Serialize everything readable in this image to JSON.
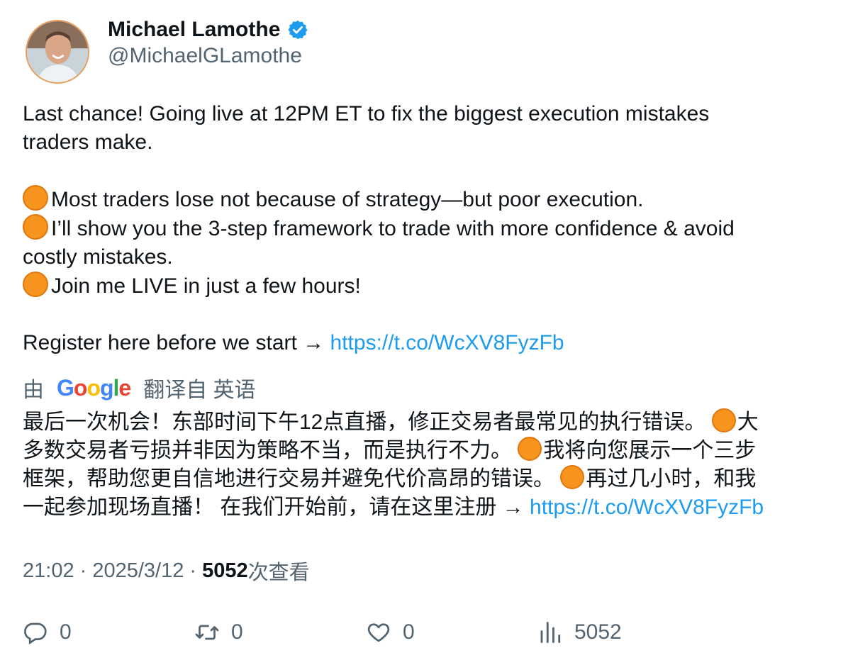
{
  "author": {
    "name": "Michael Lamothe",
    "handle": "@MichaelGLamothe",
    "verified": true,
    "verified_color": "#1d9bf0"
  },
  "tweet": {
    "lines": [
      "Last chance! Going live at 12PM ET to fix the biggest execution mistakes",
      "traders make.",
      "Most traders lose not because of strategy—but poor execution.",
      "I’ll show you the 3-step framework to trade with more confidence & avoid",
      "costly mistakes.",
      "Join me LIVE in just a few hours!",
      "Register here before we start → ",
      "https://t.co/WcXV8FyzFb"
    ],
    "bullet_icon": "orange-circle-emoji",
    "bullet_color": "#f7941d",
    "link_color": "#1d9bf0"
  },
  "translation": {
    "prefix": "由",
    "brand": "Google",
    "suffix": "翻译自 英语",
    "lines": [
      "最后一次机会！东部时间下午12点直播，修正交易者最常见的执行错误。 ",
      "大",
      "多数交易者亏损并非因为策略不当，而是执行不力。 ",
      "我将向您展示一个三步",
      "框架，帮助您更自信地进行交易并避免代价高昂的错误。 ",
      "再过几小时，和我",
      "一起参加现场直播！ 在我们开始前，请在这里注册 → ",
      "https://t.co/WcXV8FyzFb"
    ]
  },
  "meta": {
    "time": "21:02",
    "sep1": " · ",
    "date": "2025/3/12",
    "sep2": " · ",
    "views_count": "5052",
    "views_label": "次查看"
  },
  "actions": {
    "reply_count": "0",
    "retweet_count": "0",
    "like_count": "0",
    "views_count": "5052"
  }
}
